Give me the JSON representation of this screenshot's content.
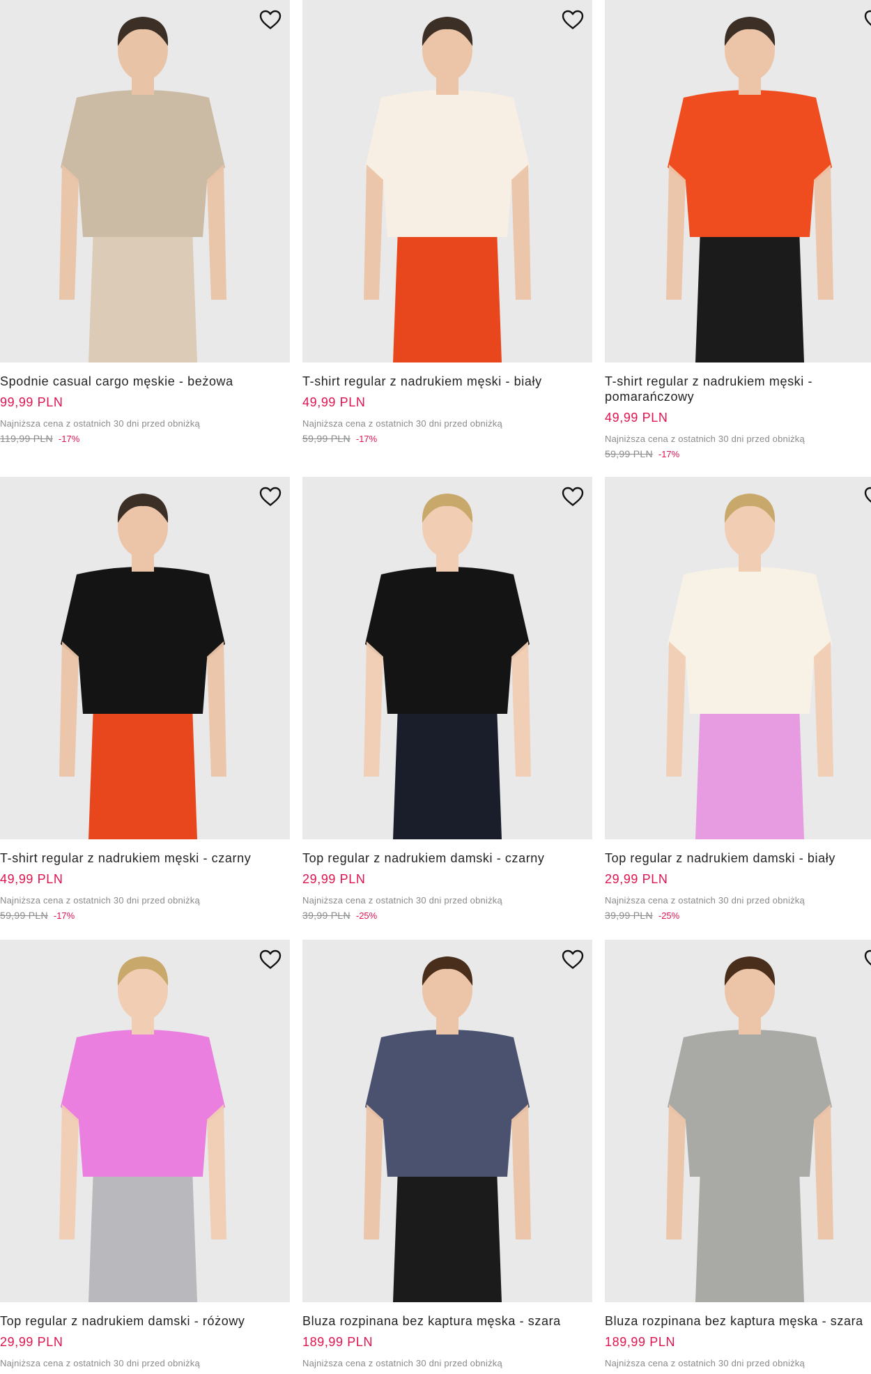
{
  "currency_note": "Najniższa cena z ostatnich 30 dni przed obniżką",
  "colors": {
    "accent": "#e0134f",
    "muted": "#8a8a8a",
    "image_bg": "#e9e9ea"
  },
  "products": [
    {
      "title": "Spodnie casual cargo męskie - beżowa",
      "price": "99,99 PLN",
      "lowest_label": "Najniższa cena z ostatnich 30 dni przed obniżką",
      "old_price": "119,99 PLN",
      "discount": "-17%",
      "icon": "heart-outline-icon",
      "top": "#cbbba5",
      "bottom": "#dccbb7",
      "skin": "#e9c3a6",
      "hair": "#3c2f26"
    },
    {
      "title": "T-shirt regular z nadrukiem męski - biały",
      "price": "49,99 PLN",
      "lowest_label": "Najniższa cena z ostatnich 30 dni przed obniżką",
      "old_price": "59,99 PLN",
      "discount": "-17%",
      "icon": "heart-outline-icon",
      "top": "#f7efe3",
      "bottom": "#e8471d",
      "skin": "#ecc4a8",
      "hair": "#3c2f26"
    },
    {
      "title": "T-shirt regular z nadrukiem męski - pomarańczowy",
      "price": "49,99 PLN",
      "lowest_label": "Najniższa cena z ostatnich 30 dni przed obniżką",
      "old_price": "59,99 PLN",
      "discount": "-17%",
      "icon": "heart-outline-icon",
      "top": "#ef4d1f",
      "bottom": "#1b1b1b",
      "skin": "#ecc4a8",
      "hair": "#3c2f26"
    },
    {
      "title": "T-shirt regular z nadrukiem męski - czarny",
      "price": "49,99 PLN",
      "lowest_label": "Najniższa cena z ostatnich 30 dni przed obniżką",
      "old_price": "59,99 PLN",
      "discount": "-17%",
      "icon": "heart-outline-icon",
      "top": "#141414",
      "bottom": "#e8471d",
      "skin": "#ecc4a8",
      "hair": "#3c2f26"
    },
    {
      "title": "Top regular z nadrukiem damski - czarny",
      "price": "29,99 PLN",
      "lowest_label": "Najniższa cena z ostatnich 30 dni przed obniżką",
      "old_price": "39,99 PLN",
      "discount": "-25%",
      "icon": "heart-outline-icon",
      "top": "#141414",
      "bottom": "#1a1d2a",
      "skin": "#f0cdb3",
      "hair": "#c9a86c"
    },
    {
      "title": "Top regular z nadrukiem damski - biały",
      "price": "29,99 PLN",
      "lowest_label": "Najniższa cena z ostatnich 30 dni przed obniżką",
      "old_price": "39,99 PLN",
      "discount": "-25%",
      "icon": "heart-outline-icon",
      "top": "#f7f1e6",
      "bottom": "#e79be0",
      "skin": "#f0cdb3",
      "hair": "#c9a86c"
    },
    {
      "title": "Top regular z nadrukiem damski - różowy",
      "price": "29,99 PLN",
      "lowest_label": "Najniższa cena z ostatnich 30 dni przed obniżką",
      "old_price": "",
      "discount": "",
      "icon": "heart-outline-icon",
      "top": "#ea7fe0",
      "bottom": "#b9b9bd",
      "skin": "#f0cdb3",
      "hair": "#c9a86c"
    },
    {
      "title": "Bluza rozpinana bez kaptura męska - szara",
      "price": "189,99 PLN",
      "lowest_label": "Najniższa cena z ostatnich 30 dni przed obniżką",
      "old_price": "",
      "discount": "",
      "icon": "heart-outline-icon",
      "top": "#4a5270",
      "bottom": "#1b1b1b",
      "skin": "#ecc4a8",
      "hair": "#4a2e1c"
    },
    {
      "title": "Bluza rozpinana bez kaptura męska - szara",
      "price": "189,99 PLN",
      "lowest_label": "Najniższa cena z ostatnich 30 dni przed obniżką",
      "old_price": "",
      "discount": "",
      "icon": "heart-outline-icon",
      "top": "#a9aaa5",
      "bottom": "#a9aaa5",
      "skin": "#ecc4a8",
      "hair": "#4a2e1c"
    }
  ]
}
